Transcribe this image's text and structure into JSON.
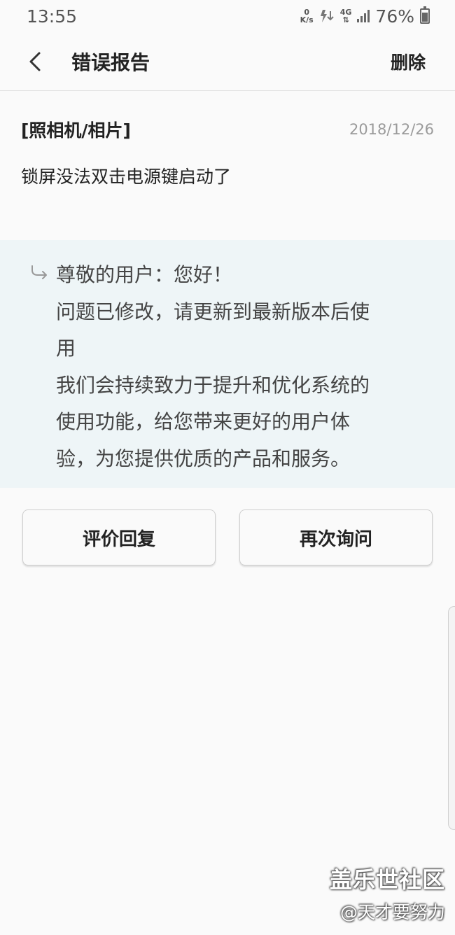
{
  "status_bar": {
    "time": "13:55",
    "net_speed_value": "0",
    "net_speed_unit": "K/s",
    "network_type": "4G",
    "battery": "76%"
  },
  "header": {
    "title": "错误报告",
    "delete_label": "删除"
  },
  "report": {
    "category": "[照相机/相片]",
    "date": "2018/12/26",
    "body": "锁屏没法双击电源键启动了"
  },
  "reply": {
    "lines": [
      "尊敬的用户：您好！",
      "问题已修改，请更新到最新版本后使",
      "用",
      "我们会持续致力于提升和优化系统的",
      "使用功能，给您带来更好的用户体",
      "验，为您提供优质的产品和服务。"
    ]
  },
  "actions": {
    "rate_reply": "评价回复",
    "ask_again": "再次询问"
  },
  "watermark": {
    "title": "盖乐世社区",
    "author": "@天才要努力"
  }
}
